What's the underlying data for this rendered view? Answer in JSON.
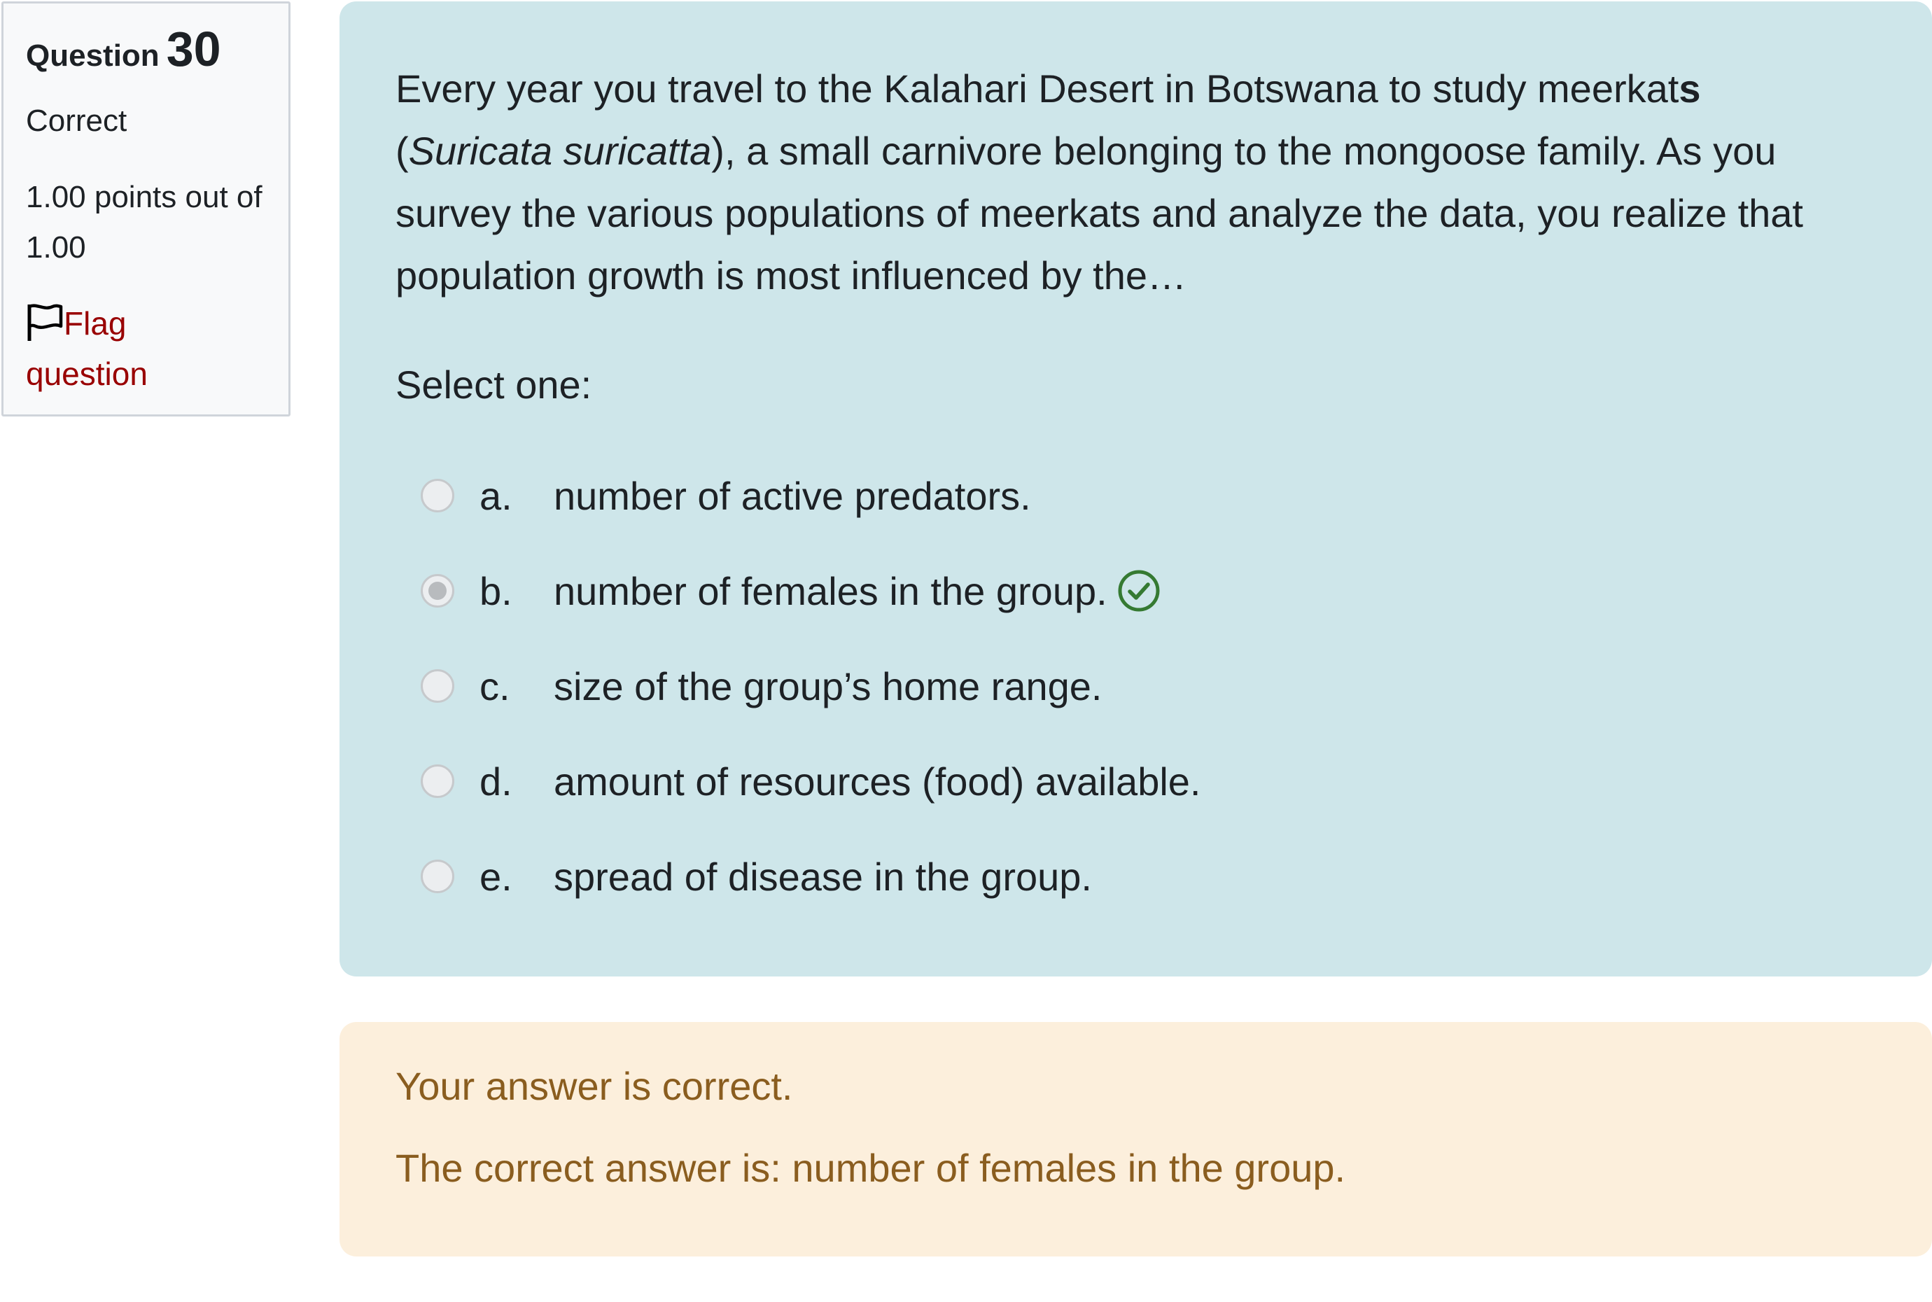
{
  "info": {
    "question_label": "Question",
    "question_number": "30",
    "state": "Correct",
    "grade": "1.00 points out of 1.00",
    "flag_label_line1": "Flag",
    "flag_label_line2": "question"
  },
  "question": {
    "text_part1": "Every year you travel to the Kalahari Desert in Botswana to study meerkat",
    "text_bold_s": "s",
    "text_part2_open": "(",
    "text_italic": "Suricata suricatta",
    "text_part3": "), a small carnivore belonging to the mongoose family.  As you survey the various populations of meerkats and analyze the data, you realize that population growth is most influenced by the…",
    "prompt": "Select one:",
    "options": [
      {
        "letter": "a.",
        "text": "number of active predators.",
        "selected": false
      },
      {
        "letter": "b.",
        "text": "number of females in the group.",
        "selected": true,
        "correct": true
      },
      {
        "letter": "c.",
        "text": "size of the group’s home range.",
        "selected": false
      },
      {
        "letter": "d.",
        "text": "amount of resources (food) available.",
        "selected": false
      },
      {
        "letter": "e.",
        "text": "spread of disease in the group.",
        "selected": false
      }
    ]
  },
  "feedback": {
    "result": "Your answer is correct.",
    "correct_answer": "The correct answer is: number of females in the group."
  },
  "colors": {
    "question_bg": "#cee6ea",
    "feedback_bg": "#fcefdc",
    "feedback_text": "#8a5d1f",
    "flag_link": "#990000",
    "check_green": "#357a32"
  },
  "icons": {
    "flag": "flag-icon",
    "correct": "check-circle-icon"
  }
}
